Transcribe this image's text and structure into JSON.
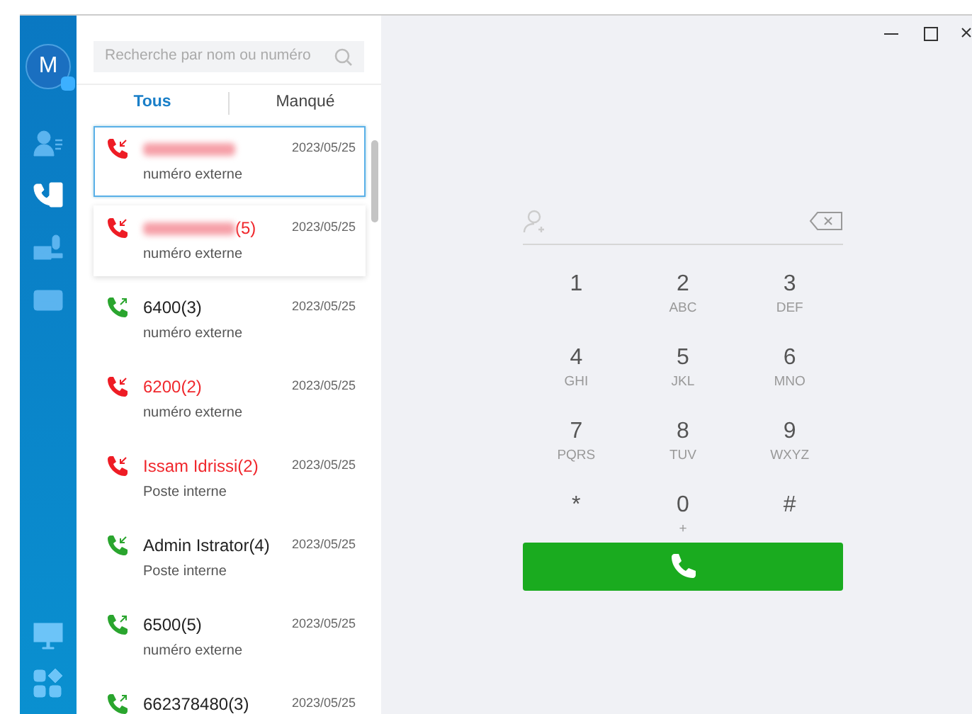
{
  "sidebar": {
    "avatar": {
      "initial": "M"
    },
    "items": [
      {
        "kind": "contacts",
        "selected": false
      },
      {
        "kind": "calllog",
        "selected": true
      },
      {
        "kind": "voicemail",
        "selected": false
      },
      {
        "kind": "recordings",
        "selected": false
      }
    ],
    "bottom_items": [
      {
        "kind": "monitor"
      },
      {
        "kind": "apps"
      }
    ]
  },
  "search": {
    "placeholder": "Recherche par nom ou numéro"
  },
  "tabs": [
    {
      "label": "Tous",
      "selected": true
    },
    {
      "label": "Manqué",
      "selected": false
    }
  ],
  "calls": [
    {
      "kind": "incoming",
      "redacted": true,
      "date": "2023/05/25",
      "subtitle": "numéro externe",
      "missed": true,
      "selected": true,
      "hovered": false
    },
    {
      "kind": "incoming",
      "redacted": true,
      "name": "(5)",
      "date": "2023/05/25",
      "subtitle": "numéro externe",
      "missed": true,
      "selected": false,
      "hovered": true
    },
    {
      "kind": "outgoing",
      "redacted": false,
      "name": "6400(3)",
      "date": "2023/05/25",
      "subtitle": "numéro externe",
      "missed": false,
      "selected": false,
      "hovered": false
    },
    {
      "kind": "incoming",
      "redacted": false,
      "name": "6200(2)",
      "date": "2023/05/25",
      "subtitle": "numéro externe",
      "missed": true,
      "selected": false,
      "hovered": false
    },
    {
      "kind": "incoming",
      "redacted": false,
      "name": "Issam Idrissi(2)",
      "date": "2023/05/25",
      "subtitle": "Poste interne",
      "missed": true,
      "selected": false,
      "hovered": false
    },
    {
      "kind": "incoming",
      "redacted": false,
      "name": "Admin Istrator(4)",
      "date": "2023/05/25",
      "subtitle": "Poste interne",
      "missed": false,
      "selected": false,
      "hovered": false
    },
    {
      "kind": "outgoing",
      "redacted": false,
      "name": "6500(5)",
      "date": "2023/05/25",
      "subtitle": "numéro externe",
      "missed": false,
      "selected": false,
      "hovered": false
    },
    {
      "kind": "outgoing",
      "redacted": false,
      "name": "662378480(3)",
      "date": "2023/05/25",
      "missed": false,
      "selected": false,
      "hovered": false
    }
  ],
  "keypad": [
    {
      "digit": "1"
    },
    {
      "digit": "2",
      "letters": "ABC"
    },
    {
      "digit": "3",
      "letters": "DEF"
    },
    {
      "digit": "4",
      "letters": "GHI"
    },
    {
      "digit": "5",
      "letters": "JKL"
    },
    {
      "digit": "6",
      "letters": "MNO"
    },
    {
      "digit": "7",
      "letters": "PQRS"
    },
    {
      "digit": "8",
      "letters": "TUV"
    },
    {
      "digit": "9",
      "letters": "WXYZ"
    },
    {
      "digit": "*"
    },
    {
      "digit": "0",
      "letters": "+"
    },
    {
      "digit": "#"
    }
  ]
}
